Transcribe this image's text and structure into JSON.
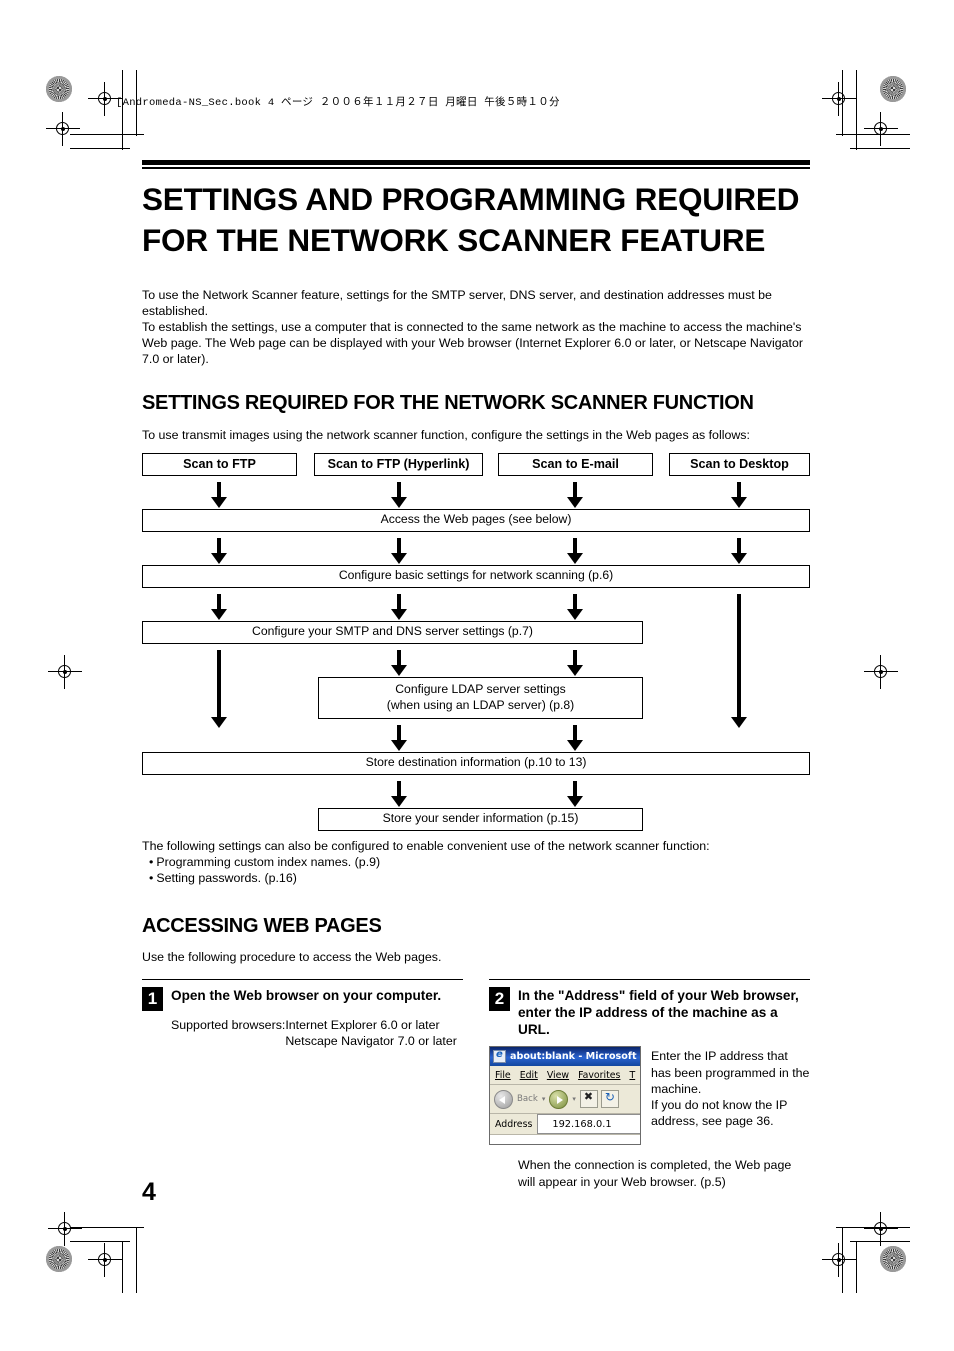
{
  "page": {
    "file_header": "[Andromeda-NS_Sec.book   4 ページ   ２００６年１１月２７日   月曜日   午後５時１０分",
    "number": "4"
  },
  "title": "SETTINGS AND PROGRAMMING REQUIRED FOR THE NETWORK SCANNER FEATURE",
  "intro": "To use the Network Scanner feature, settings for the SMTP server, DNS server, and destination addresses must be established.\nTo establish the settings, use a computer that is connected to the same network as the machine to access the machine's Web page. The Web page can be displayed with your Web browser (Internet Explorer 6.0 or later, or Netscape Navigator 7.0 or later).",
  "section1": {
    "heading": "SETTINGS REQUIRED FOR THE NETWORK SCANNER FUNCTION",
    "lead": "To use transmit images using the network scanner function, configure the settings in the Web pages as follows:",
    "flow": {
      "top_boxes": [
        "Scan to FTP",
        "Scan to FTP (Hyperlink)",
        "Scan to E-mail",
        "Scan to Desktop"
      ],
      "steps": [
        "Access the Web pages (see below)",
        "Configure basic settings for network scanning (p.6)",
        "Configure your SMTP and DNS server settings (p.7)",
        "Configure LDAP server settings\n(when using an LDAP server) (p.8)",
        "Store destination information (p.10 to 13)",
        "Store your sender information (p.15)"
      ],
      "ldap_line1": "Configure LDAP server settings",
      "ldap_line2": "(when using an LDAP server) (p.8)"
    },
    "after_lead": "The following settings can also be configured to enable convenient use of the network scanner function:",
    "bullets": [
      "Programming custom index names. (p.9)",
      "Setting passwords. (p.16)"
    ]
  },
  "section2": {
    "heading": "ACCESSING WEB PAGES",
    "lead": "Use the following procedure to access the Web pages.",
    "step1": {
      "number": "1",
      "title": "Open the Web browser on your computer.",
      "supported_label": "Supported browsers:",
      "supported_values": "Internet Explorer 6.0 or later\nNetscape Navigator 7.0 or later"
    },
    "step2": {
      "number": "2",
      "title": "In the \"Address\" field of your Web browser, enter the IP address of the machine as a URL.",
      "note": "Enter the IP address that has been programmed in the machine.\nIf you do not know the IP address, see page 36.",
      "footer": "When the connection is completed, the Web page will appear in your Web browser. (p.5)",
      "browser": {
        "title": "about:blank - Microsoft In",
        "menu": [
          "File",
          "Edit",
          "View",
          "Favorites",
          "T"
        ],
        "back_label": "Back",
        "address_label": "Address",
        "address_value": "192.168.0.1"
      }
    }
  }
}
